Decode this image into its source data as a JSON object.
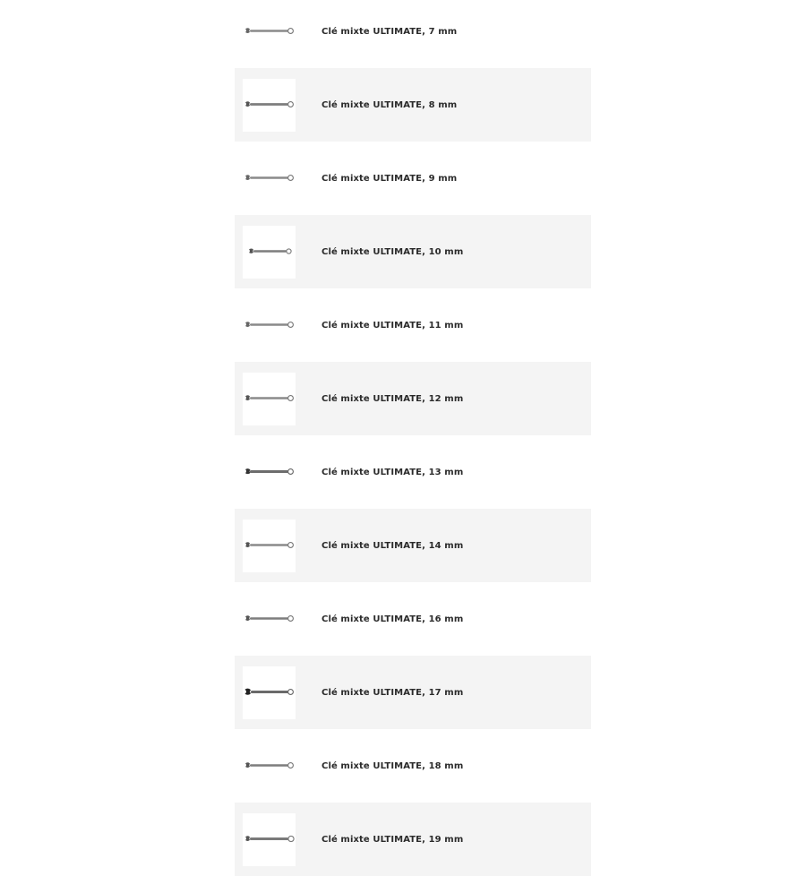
{
  "products": [
    {
      "name": "Clé mixte ULTIMATE, 7 mm",
      "thumb_icon": "combination-wrench-icon"
    },
    {
      "name": "Clé mixte ULTIMATE, 8 mm",
      "thumb_icon": "combination-wrench-icon"
    },
    {
      "name": "Clé mixte ULTIMATE, 9 mm",
      "thumb_icon": "combination-wrench-icon"
    },
    {
      "name": "Clé mixte ULTIMATE, 10 mm",
      "thumb_icon": "combination-wrench-icon"
    },
    {
      "name": "Clé mixte ULTIMATE, 11 mm",
      "thumb_icon": "combination-wrench-icon"
    },
    {
      "name": "Clé mixte ULTIMATE, 12 mm",
      "thumb_icon": "combination-wrench-icon"
    },
    {
      "name": "Clé mixte ULTIMATE, 13 mm",
      "thumb_icon": "combination-wrench-icon"
    },
    {
      "name": "Clé mixte ULTIMATE, 14 mm",
      "thumb_icon": "combination-wrench-icon"
    },
    {
      "name": "Clé mixte ULTIMATE, 16 mm",
      "thumb_icon": "combination-wrench-icon"
    },
    {
      "name": "Clé mixte ULTIMATE, 17 mm",
      "thumb_icon": "combination-wrench-icon"
    },
    {
      "name": "Clé mixte ULTIMATE, 18 mm",
      "thumb_icon": "combination-wrench-icon"
    },
    {
      "name": "Clé mixte ULTIMATE, 19 mm",
      "thumb_icon": "combination-wrench-icon"
    }
  ],
  "colors": {
    "row_alt_background": "#f4f4f4",
    "text": "#2b2b2b",
    "wrench_metal": "#8a8a8a"
  }
}
